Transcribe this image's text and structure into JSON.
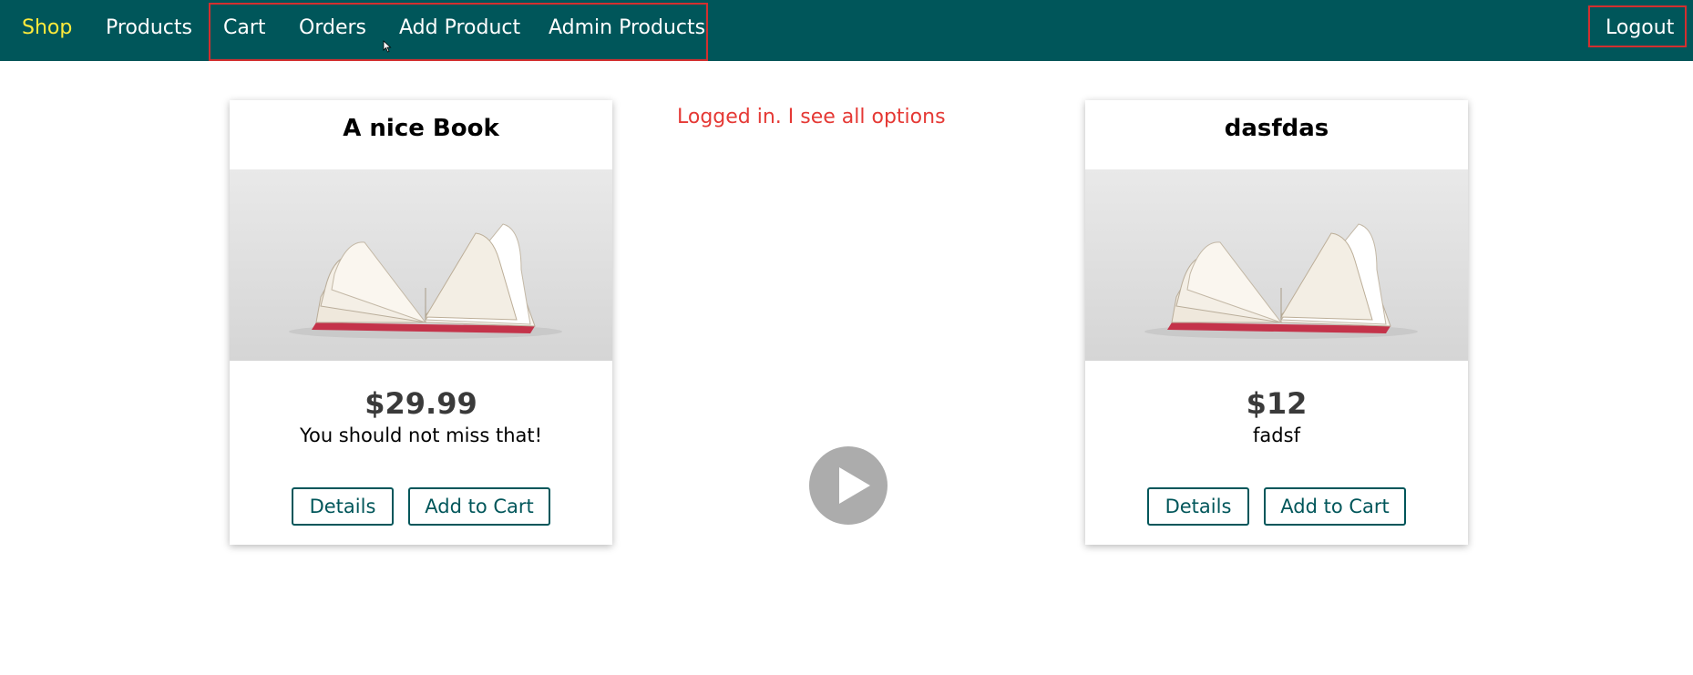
{
  "nav": {
    "shop": "Shop",
    "products": "Products",
    "cart": "Cart",
    "orders": "Orders",
    "add_product": "Add Product",
    "admin_products": "Admin Products",
    "logout": "Logout"
  },
  "annotation": "Logged in. I see all options",
  "products": [
    {
      "title": "A nice Book",
      "price": "$29.99",
      "description": "You should not miss that!",
      "details_label": "Details",
      "cart_label": "Add to Cart"
    },
    {
      "title": "dasfdas",
      "price": "$12",
      "description": "fadsf",
      "details_label": "Details",
      "cart_label": "Add to Cart"
    }
  ],
  "colors": {
    "nav_bg": "#00565a",
    "active_link": "#ffeb3b",
    "highlight": "#d32f2f",
    "annotation": "#e53935"
  }
}
